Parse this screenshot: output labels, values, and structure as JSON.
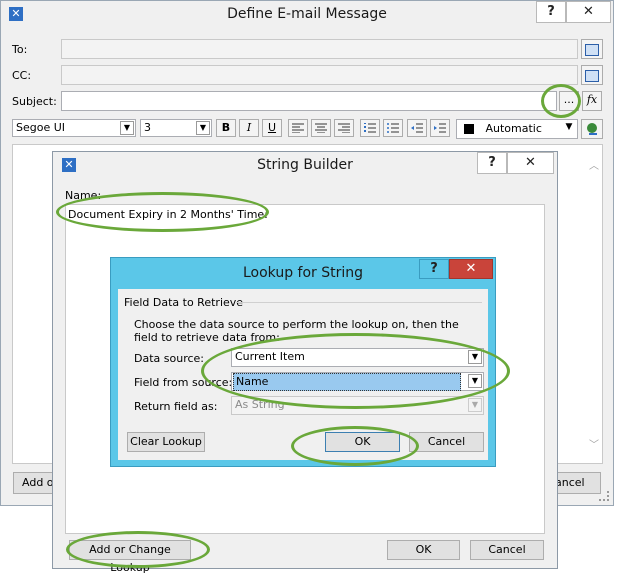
{
  "email_window": {
    "title": "Define E-mail Message",
    "help": "?",
    "close": "✕",
    "to_label": "To:",
    "cc_label": "CC:",
    "subject_label": "Subject:",
    "ellipsis": "...",
    "fx": "fx",
    "font_name": "Segoe UI",
    "font_size": "3",
    "bold": "B",
    "italic": "I",
    "underline": "U",
    "color_label": "Automatic",
    "add_button_partial": "Add or",
    "cancel_partial": "ancel"
  },
  "string_builder": {
    "title": "String Builder",
    "help": "?",
    "close": "✕",
    "name_label": "Name:",
    "value": "Document Expiry in 2 Months' Time:",
    "add_lookup": "Add or Change Lookup",
    "ok": "OK",
    "cancel": "Cancel"
  },
  "lookup": {
    "title": "Lookup for String",
    "help": "?",
    "close": "✕",
    "group": "Field Data to Retrieve",
    "description": "Choose the data source to perform the lookup on, then the field to retrieve data from:",
    "data_source_label": "Data source:",
    "data_source_value": "Current Item",
    "field_label": "Field from source:",
    "field_value": "Name",
    "return_label": "Return field as:",
    "return_value": "As String",
    "clear": "Clear Lookup",
    "ok": "OK",
    "cancel": "Cancel"
  },
  "colors": {
    "lookup_titlebar": "#5bc7e8",
    "annotation_ring": "#6aa83a",
    "lookup_close": "#c9443a",
    "selection": "#99c9ef"
  }
}
